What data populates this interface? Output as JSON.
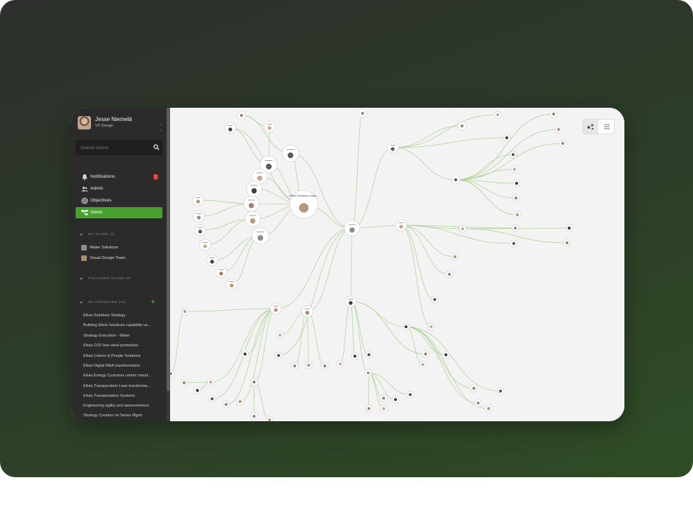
{
  "user": {
    "name": "Jesse Niemelä",
    "role": "VP Design"
  },
  "search": {
    "placeholder": "Search teams"
  },
  "nav": {
    "items": [
      {
        "label": "Notifications",
        "badge": "1",
        "icon": "bell-icon"
      },
      {
        "label": "Admin",
        "icon": "people-icon"
      },
      {
        "label": "Objectives",
        "icon": "target-icon"
      },
      {
        "label": "Views",
        "icon": "hierarchy-icon",
        "active": true
      }
    ]
  },
  "sections": {
    "my_teams": "MY TEAMS (2)",
    "followed_teams": "FOLLOWED TEAMS (0)",
    "my_programs": "MY PROGRAMS (15)"
  },
  "teams": [
    {
      "label": "Water Solutions"
    },
    {
      "label": "Visual Design Team"
    }
  ],
  "programs": [
    "Elivia Solutions Strategy",
    "Building Elivia Solutions capability us...",
    "Strategy Execution - Water",
    "Elivia CO2 free steel production",
    "Elivia Culture & People Solutions",
    "Elivia Digital M&A transformation",
    "Elivia Energy Customer centric transf...",
    "Elivia Transporation Lean transforma...",
    "Elivia Transportation Systems",
    "Engineering agility and awesomeness",
    "Strategy Creation /w Senior Mgmt"
  ],
  "graph": {
    "center_label": "Elivia Solutions Leadr..."
  },
  "colors": {
    "accent": "#48a12f",
    "badge": "#d9342b",
    "edge": "#a9cf8e",
    "sidebar": "#2b2b2c"
  },
  "view_toggle": {
    "graph_icon": "graph-view-icon",
    "list_icon": "list-view-icon"
  }
}
